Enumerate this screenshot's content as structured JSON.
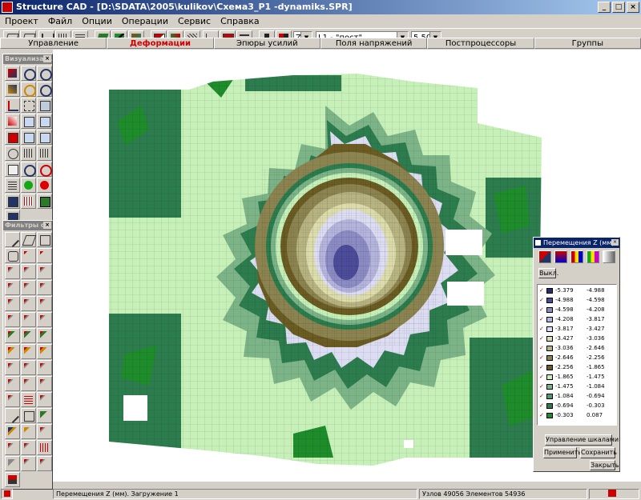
{
  "window": {
    "title": "Structure CAD - [D:\\SDATA\\2005\\kulikov\\Схема3_P1 -dynamiks.SPR]"
  },
  "menu": [
    "Проект",
    "Файл",
    "Опции",
    "Операции",
    "Сервис",
    "Справка"
  ],
  "toolbar": {
    "z_select": "Z",
    "load_select": "L1 - \"пост\"",
    "scale_select": "5.500"
  },
  "tabs": [
    {
      "label": "Управление",
      "active": false
    },
    {
      "label": "Деформации",
      "active": true
    },
    {
      "label": "Эпюры усилий",
      "active": false
    },
    {
      "label": "Поля напряжений",
      "active": false
    },
    {
      "label": "Постпроцессоры",
      "active": false
    },
    {
      "label": "Группы",
      "active": false
    }
  ],
  "palettes": {
    "viz_title": "Визуализац...",
    "filter_title": "Фильтры от..."
  },
  "legend": {
    "title": "Перемещения Z (мм)",
    "off_button": "Выкл.",
    "rows": [
      {
        "from": "-5.379",
        "to": "-4.988",
        "color": "#2a2c72"
      },
      {
        "from": "-4.988",
        "to": "-4.598",
        "color": "#4c4c9a"
      },
      {
        "from": "-4.598",
        "to": "-4.208",
        "color": "#8c8cc4"
      },
      {
        "from": "-4.208",
        "to": "-3.817",
        "color": "#b4b4dc"
      },
      {
        "from": "-3.817",
        "to": "-3.427",
        "color": "#dcdcf2"
      },
      {
        "from": "-3.427",
        "to": "-3.036",
        "color": "#dcdcac"
      },
      {
        "from": "-3.036",
        "to": "-2.646",
        "color": "#b8b482"
      },
      {
        "from": "-2.646",
        "to": "-2.256",
        "color": "#8c8450"
      },
      {
        "from": "-2.256",
        "to": "-1.865",
        "color": "#6a5c22"
      },
      {
        "from": "-1.865",
        "to": "-1.475",
        "color": "#c6f0b8"
      },
      {
        "from": "-1.475",
        "to": "-1.084",
        "color": "#7cb488"
      },
      {
        "from": "-1.084",
        "to": "-0.694",
        "color": "#4e9a6e"
      },
      {
        "from": "-0.694",
        "to": "-0.303",
        "color": "#2c7c4e"
      },
      {
        "from": "-0.303",
        "to": "0.087",
        "color": "#1e8c2a"
      }
    ],
    "manage_button": "Управление шкалами",
    "apply_button": "Применить",
    "save_button": "Сохранить",
    "close_button": "Закрыть"
  },
  "status": {
    "left": "Перемещения Z (мм). Загружение 1",
    "right": "Узлов 49056 Элементов 54936"
  }
}
